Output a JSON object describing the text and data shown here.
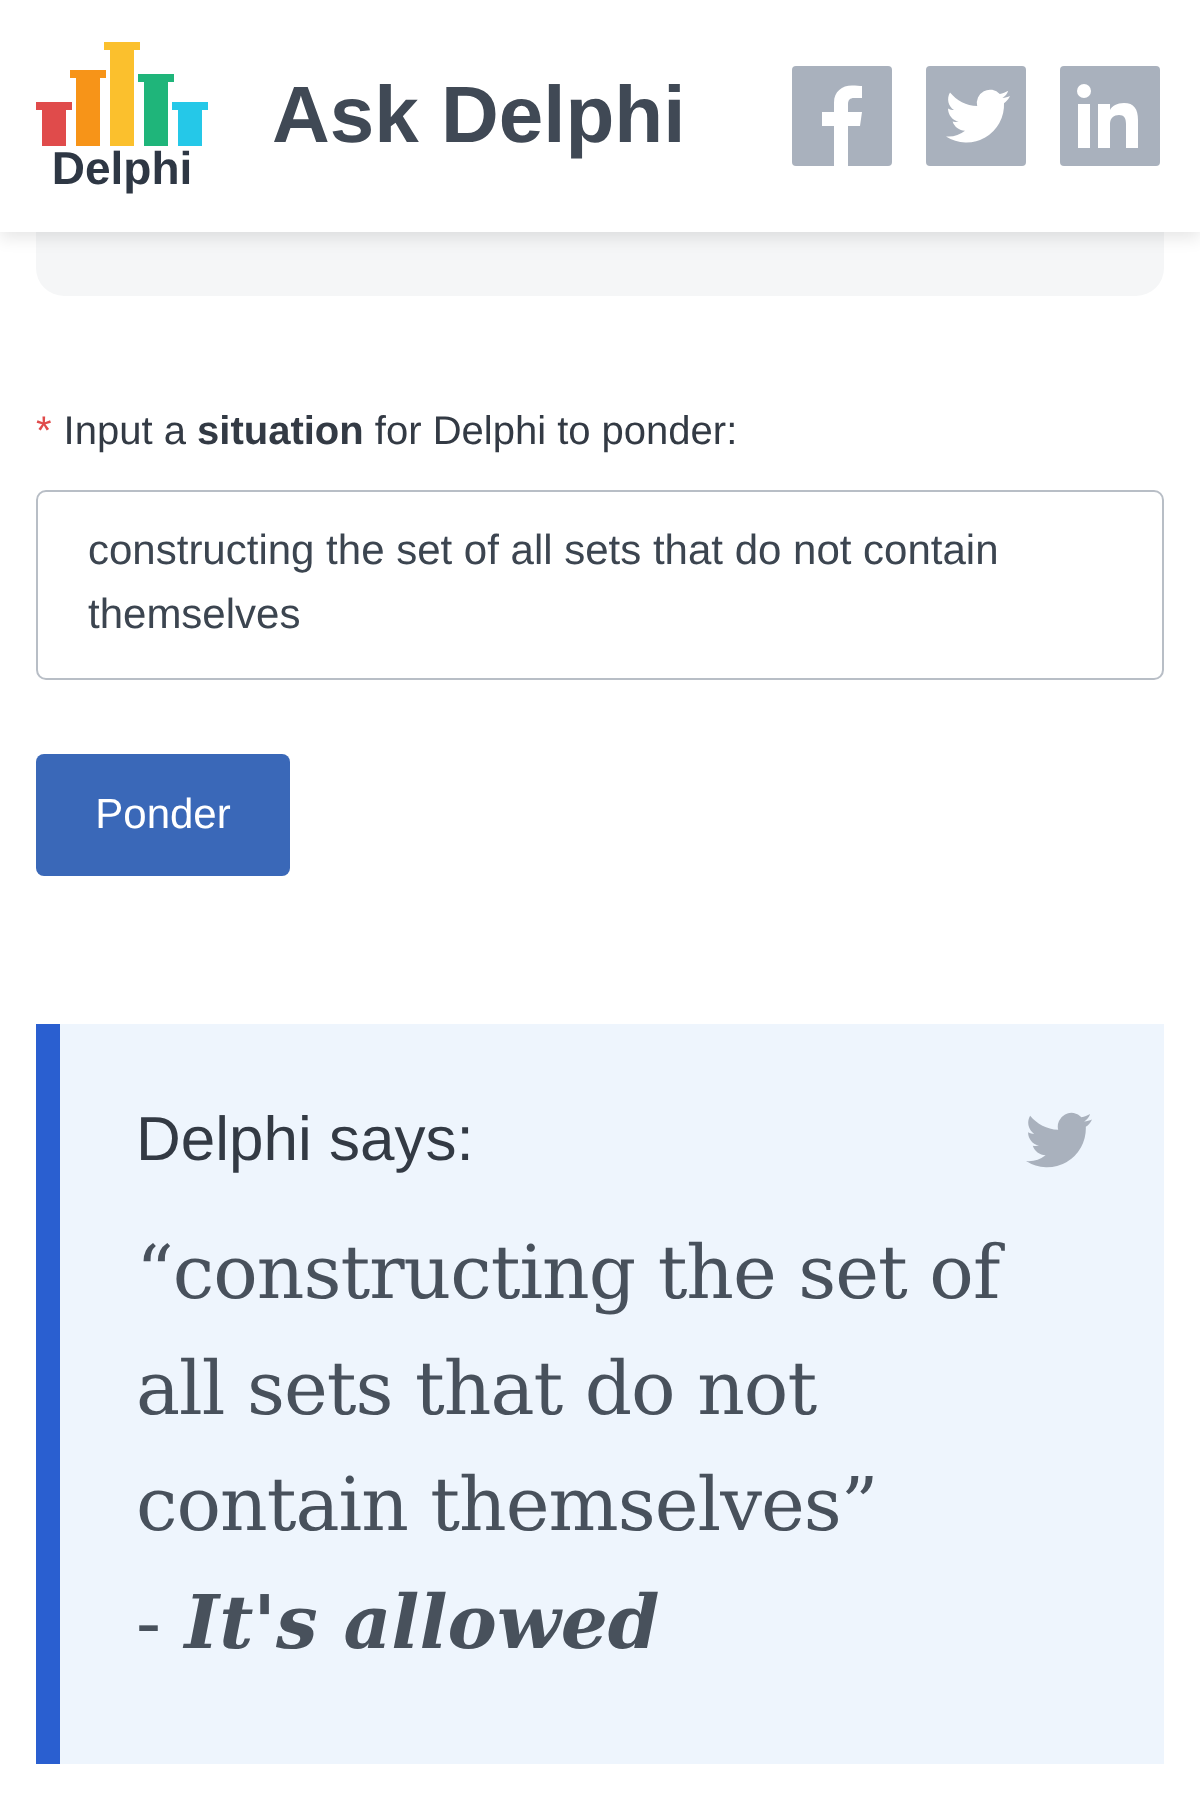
{
  "header": {
    "logo_text": "Delphi",
    "title": "Ask Delphi",
    "share": [
      {
        "kind": "facebook"
      },
      {
        "kind": "twitter"
      },
      {
        "kind": "linkedin"
      }
    ]
  },
  "form": {
    "required_mark": "*",
    "label": "Input a **situation** for Delphi to ponder:",
    "value": "constructing the set of all sets that do not contain themselves",
    "button": "Ponder"
  },
  "answer": {
    "heading": "Delphi says:",
    "quote": "“constructing the set of all sets that do not contain themselves”",
    "verdict": "- **It's allowed**"
  }
}
